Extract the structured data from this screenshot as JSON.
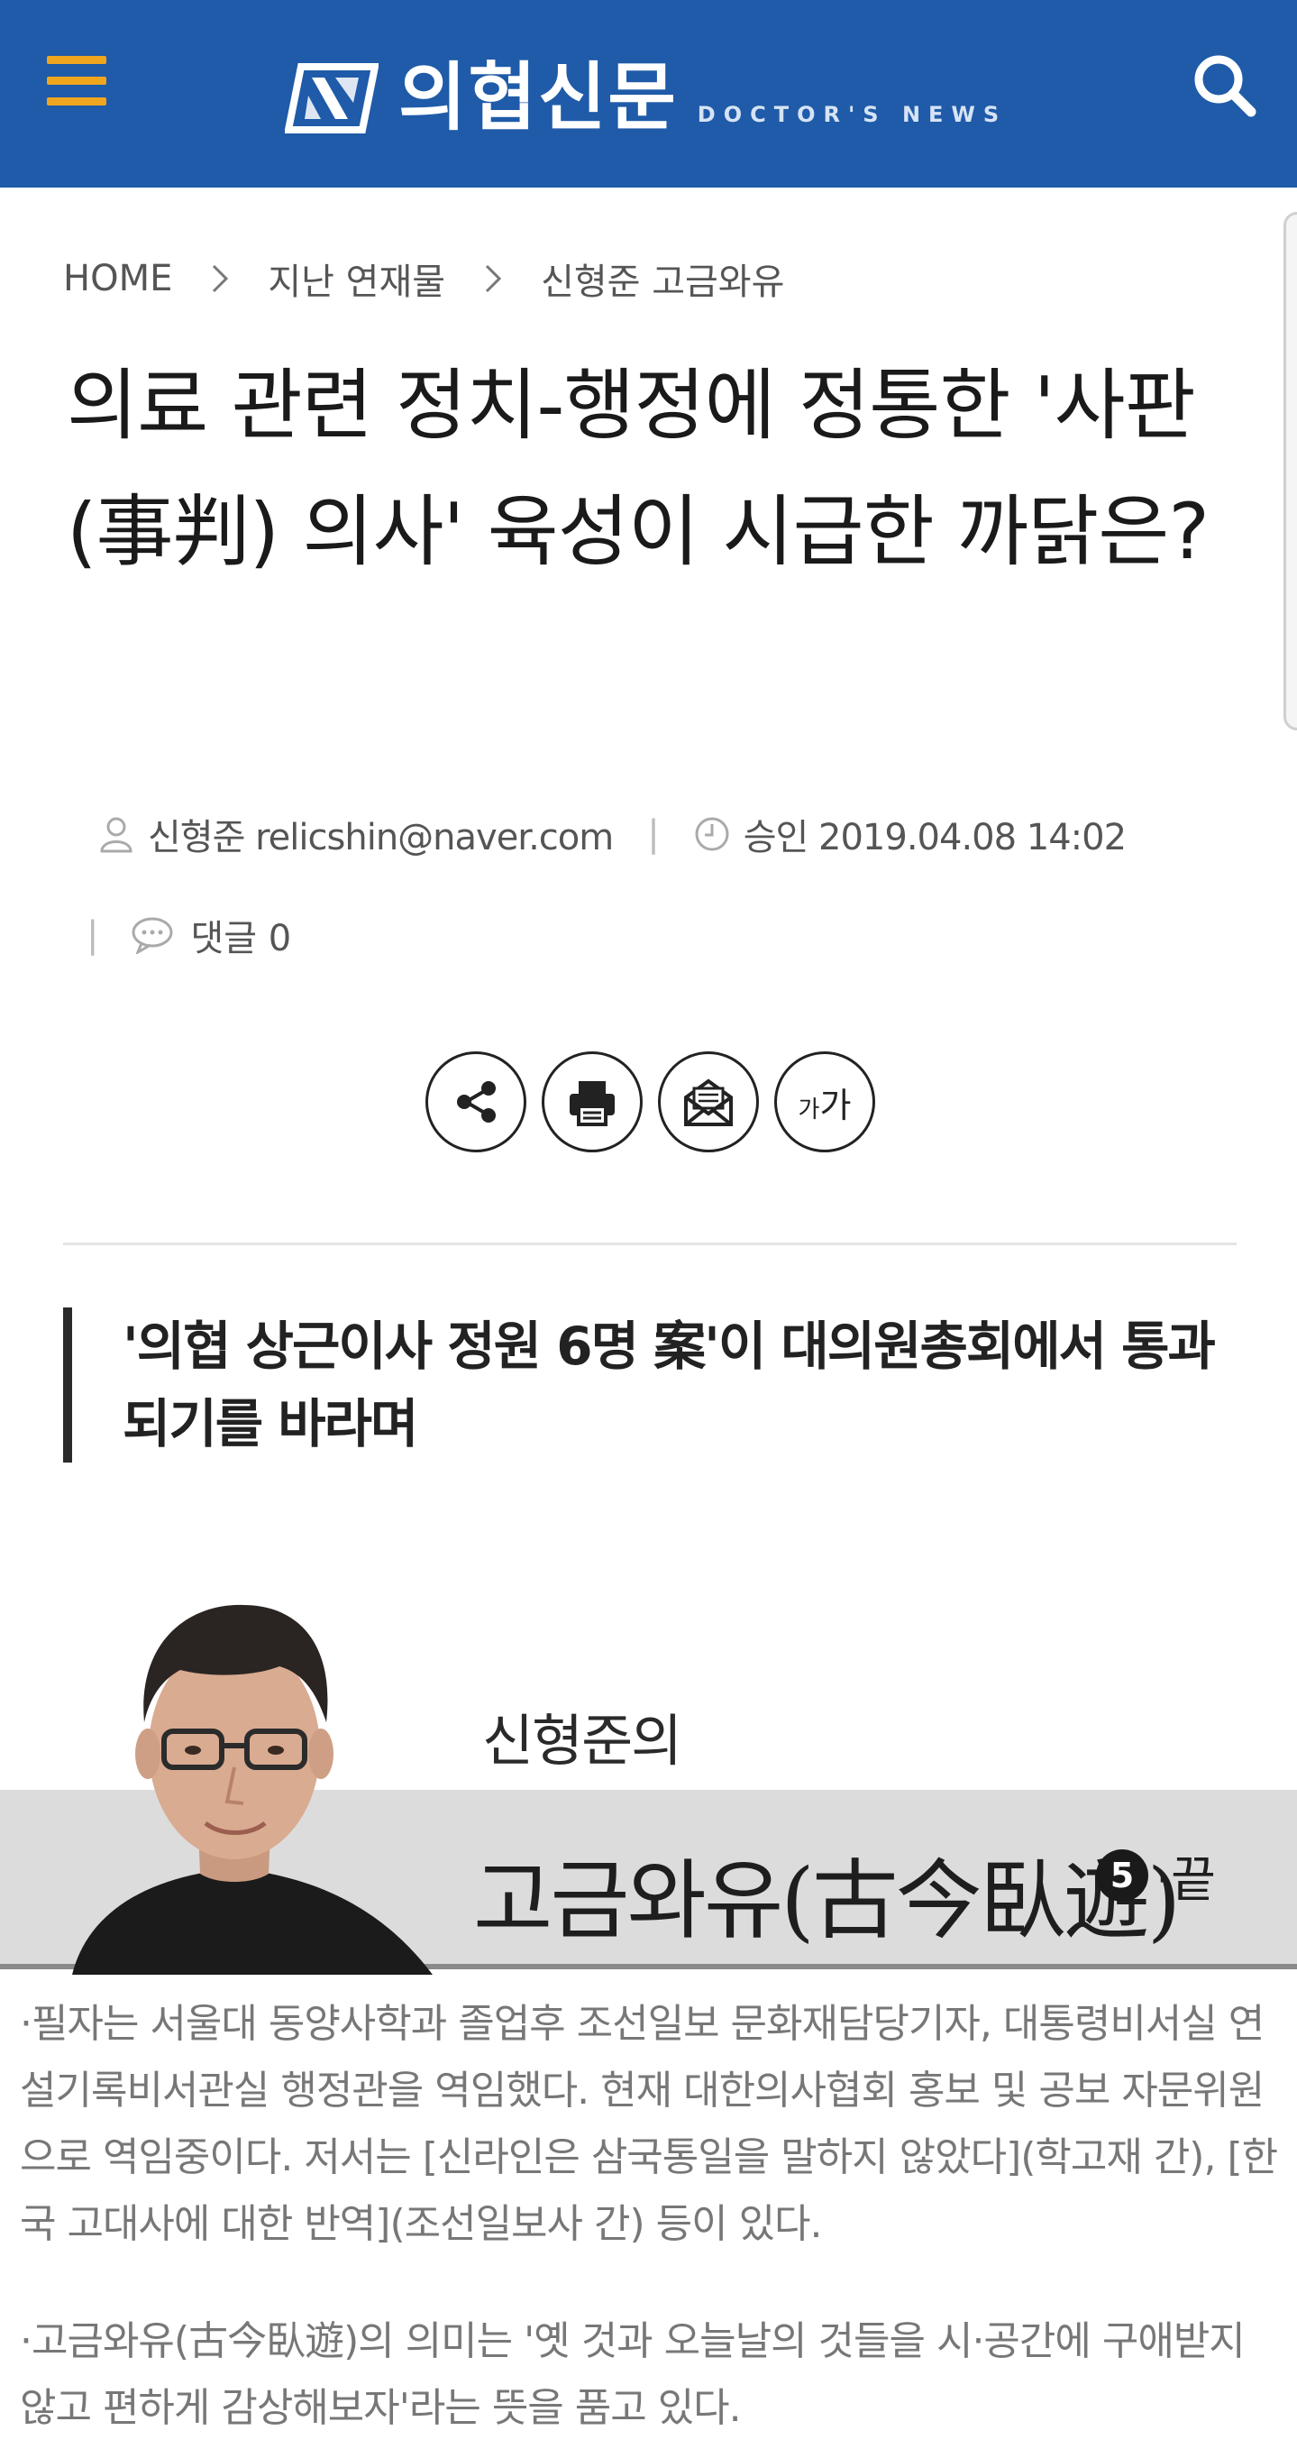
{
  "header": {
    "menu_icon": "hamburger-menu-icon",
    "brand_name": "의협신문",
    "brand_sub": "DOCTOR'S NEWS",
    "search_icon": "search-icon",
    "bg_color": "#1f5ba8",
    "accent_color": "#f0a51e"
  },
  "breadcrumb": {
    "home": "HOME",
    "section": "지난 연재물",
    "series": "신형준 고금와유"
  },
  "article": {
    "title": "의료 관련 정치-행정에 정통한 '사판(事判) 의사' 육성이 시급한 까닭은?",
    "author": "신형준 relicshin@naver.com",
    "approved": "승인 2019.04.08 14:02",
    "comments": "댓글 0",
    "subtitle": "'의협 상근이사 정원 6명 案'이 대의원총회에서 통과되기를 바라며"
  },
  "tools": {
    "share": "share-icon",
    "print": "print-icon",
    "email": "email-icon",
    "font_small": "가",
    "font_large": "가"
  },
  "banner": {
    "name": "신형준의",
    "series": "고금와유(古今臥遊)",
    "number": "5",
    "suffix": "·끝"
  },
  "notes": {
    "author_bio": "·필자는 서울대 동양사학과 졸업후 조선일보 문화재담당기자, 대통령비서실 연설기록비서관실 행정관을 역임했다. 현재 대한의사협회 홍보 및 공보 자문위원으로 역임중이다. 저서는 [신라인은 삼국통일을 말하지 않았다](학고재 간), [한국 고대사에 대한 반역](조선일보사 간) 등이 있다.",
    "series_meaning": "·고금와유(古今臥遊)의 의미는 '옛 것과 오늘날의 것들을 시·공간에 구애받지 않고 편하게 감상해보자'라는 뜻을 품고 있다."
  }
}
